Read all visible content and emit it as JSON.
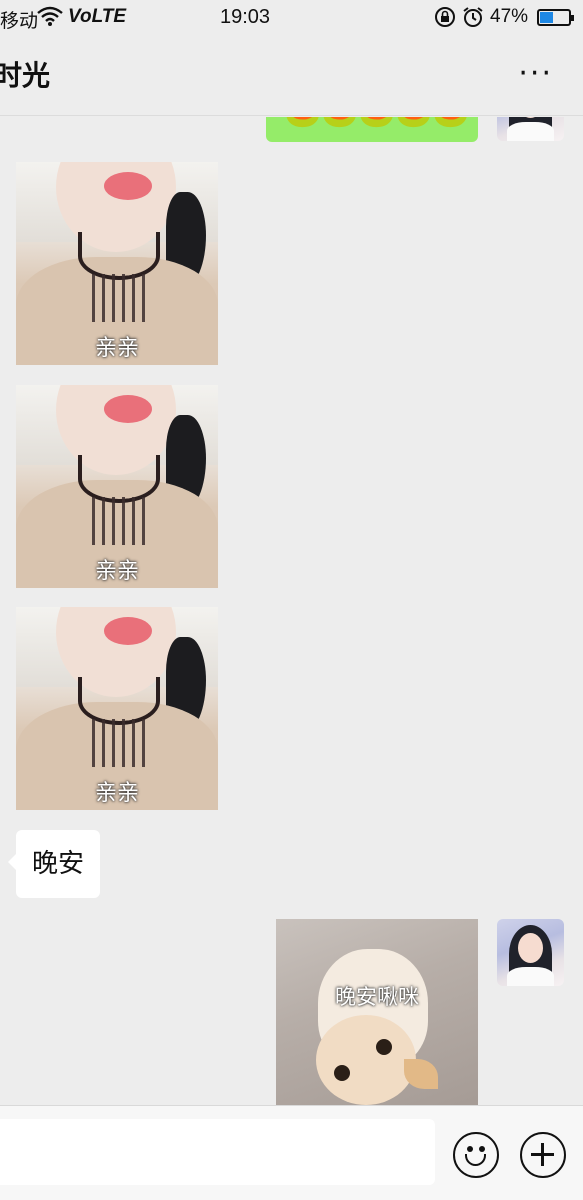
{
  "status_bar": {
    "carrier": "移动",
    "network": "VoLTE",
    "time": "19:03",
    "battery_percent": "47%",
    "battery_level": 0.47,
    "icons": [
      "wifi-icon",
      "orientation-lock-icon",
      "alarm-icon",
      "battery-icon"
    ]
  },
  "header": {
    "title": "时光",
    "more_label": "···"
  },
  "messages": {
    "partial_green": {
      "emoji": "🐸"
    },
    "stickers": [
      {
        "caption": "亲亲"
      },
      {
        "caption": "亲亲"
      },
      {
        "caption": "亲亲"
      }
    ],
    "text_bubble": {
      "text": "晚安"
    },
    "cat_sticker": {
      "caption": "晚安啾咪"
    }
  },
  "input_bar": {
    "placeholder": "",
    "icons": [
      "emoji-icon",
      "plus-icon"
    ]
  },
  "colors": {
    "background": "#ededed",
    "self_bubble": "#95ec69",
    "other_bubble": "#ffffff",
    "battery_fill": "#1e88e5"
  }
}
